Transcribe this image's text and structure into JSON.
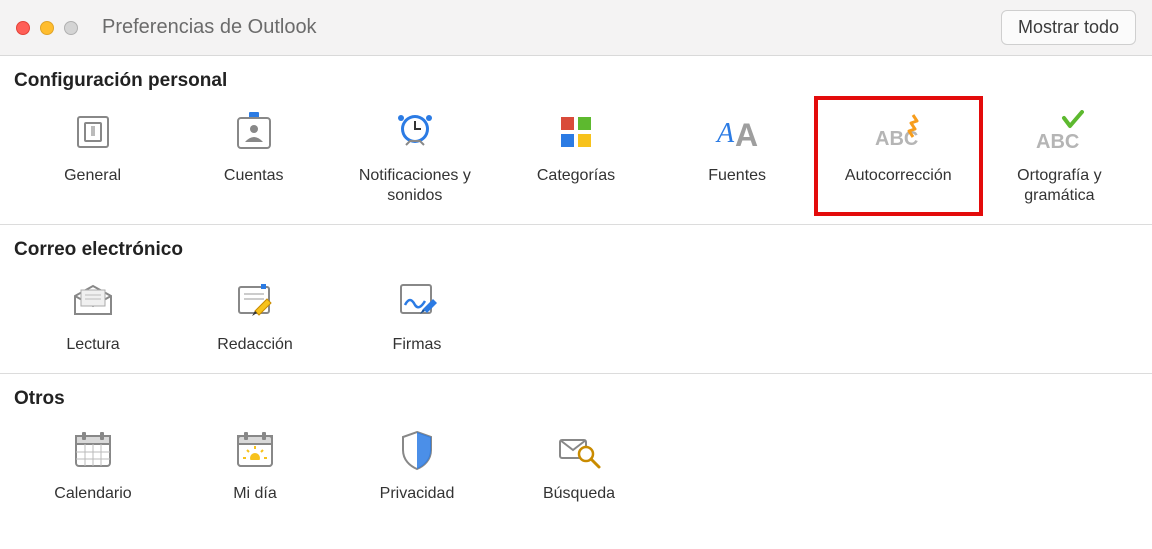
{
  "window": {
    "title": "Preferencias de Outlook",
    "show_all": "Mostrar todo"
  },
  "sections": {
    "personal": {
      "header": "Configuración personal",
      "items": {
        "general": "General",
        "accounts": "Cuentas",
        "notifications": "Notificaciones y sonidos",
        "categories": "Categorías",
        "fonts": "Fuentes",
        "autocorrect": "Autocorrección",
        "spelling": "Ortografía y gramática"
      }
    },
    "email": {
      "header": "Correo electrónico",
      "items": {
        "reading": "Lectura",
        "compose": "Redacción",
        "signatures": "Firmas"
      }
    },
    "other": {
      "header": "Otros",
      "items": {
        "calendar": "Calendario",
        "myday": "Mi día",
        "privacy": "Privacidad",
        "search": "Búsqueda"
      }
    }
  },
  "colors": {
    "highlight": "#e30b0b",
    "blue": "#2b7be4",
    "green": "#5db92f",
    "orange": "#f79d1c",
    "red": "#d94b3a",
    "grey": "#9e9e9e"
  }
}
